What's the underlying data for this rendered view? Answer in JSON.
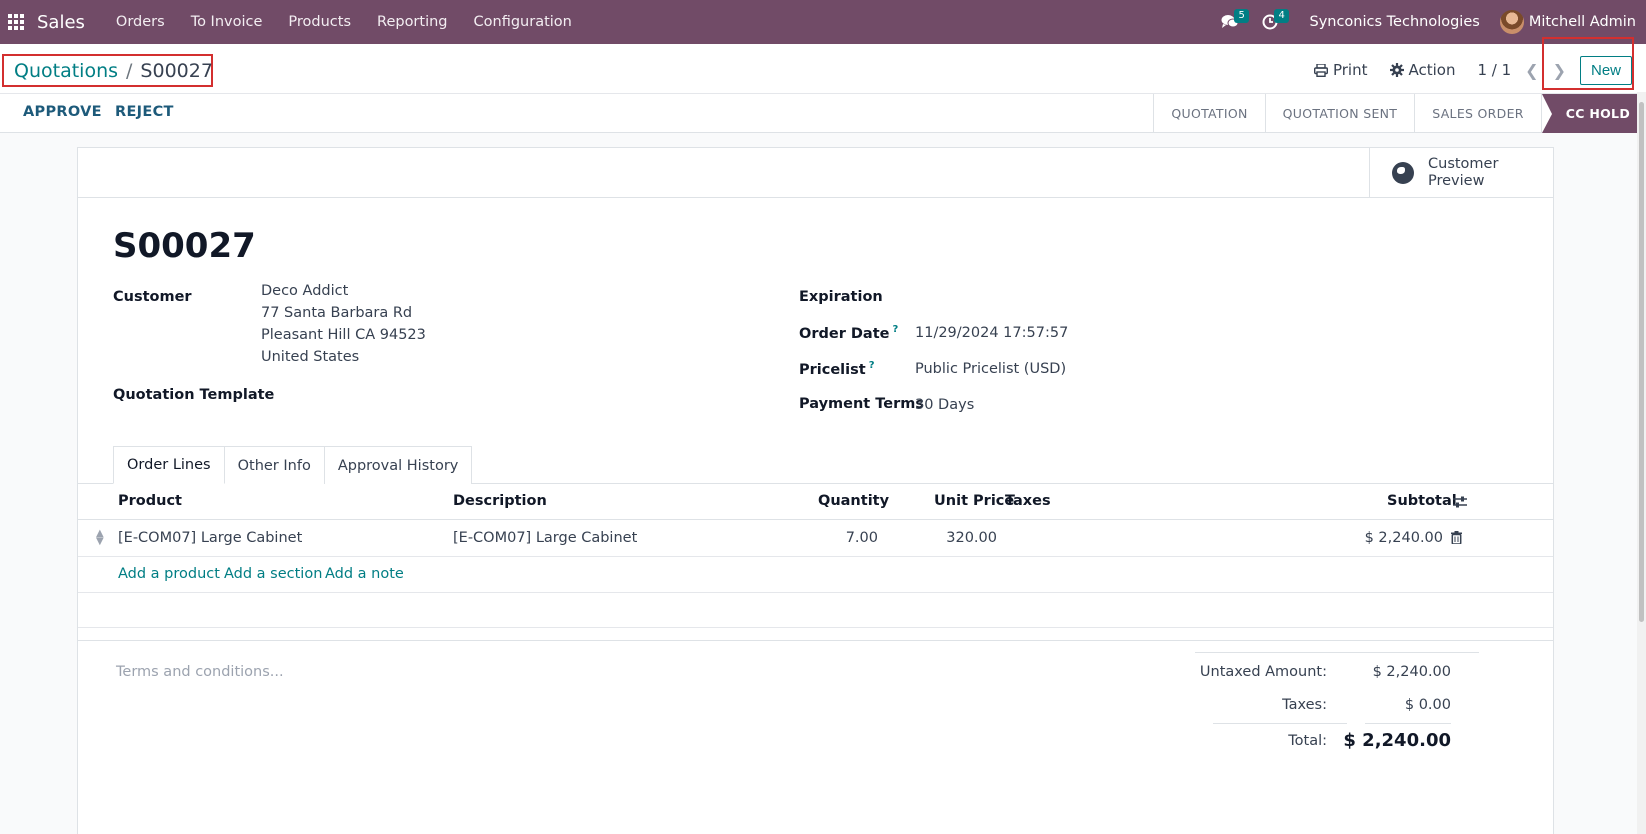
{
  "navbar": {
    "app_name": "Sales",
    "menu": [
      "Orders",
      "To Invoice",
      "Products",
      "Reporting",
      "Configuration"
    ],
    "messages_count": "5",
    "activities_count": "4",
    "company": "Synconics Technologies",
    "user": "Mitchell Admin"
  },
  "breadcrumb": {
    "parent": "Quotations",
    "separator": "/",
    "current": "S00027"
  },
  "control": {
    "print": "Print",
    "action": "Action",
    "pager": "1 / 1",
    "new": "New"
  },
  "actions": {
    "approve": "APPROVE",
    "reject": "REJECT"
  },
  "statusbar": {
    "stages": [
      "QUOTATION",
      "QUOTATION SENT",
      "SALES ORDER"
    ],
    "active": "CC HOLD"
  },
  "smart_buttons": {
    "preview_line1": "Customer",
    "preview_line2": "Preview"
  },
  "record": {
    "name": "S00027",
    "customer_label": "Customer",
    "customer": {
      "name": "Deco Addict",
      "street": "77 Santa Barbara Rd",
      "city": "Pleasant Hill CA 94523",
      "country": "United States"
    },
    "quotation_template_label": "Quotation Template",
    "expiration_label": "Expiration",
    "order_date_label": "Order Date",
    "order_date": "11/29/2024 17:57:57",
    "pricelist_label": "Pricelist",
    "pricelist": "Public Pricelist (USD)",
    "payment_terms_label": "Payment Terms",
    "payment_terms": "30 Days",
    "help_mark": "?"
  },
  "tabs": [
    "Order Lines",
    "Other Info",
    "Approval History"
  ],
  "order_lines": {
    "columns": {
      "product": "Product",
      "description": "Description",
      "quantity": "Quantity",
      "unit_price": "Unit Price",
      "taxes": "Taxes",
      "subtotal": "Subtotal"
    },
    "rows": [
      {
        "product": "[E-COM07] Large Cabinet",
        "description": "[E-COM07] Large Cabinet",
        "quantity": "7.00",
        "unit_price": "320.00",
        "taxes": "",
        "subtotal": "$ 2,240.00"
      }
    ],
    "add_product": "Add a product",
    "add_section": "Add a section",
    "add_note": "Add a note"
  },
  "footer": {
    "terms_placeholder": "Terms and conditions...",
    "untaxed_label": "Untaxed Amount:",
    "untaxed": "$ 2,240.00",
    "taxes_label": "Taxes:",
    "taxes": "$ 0.00",
    "total_label": "Total:",
    "total": "$ 2,240.00"
  },
  "colors": {
    "brand": "#714b67",
    "accent": "#017e84",
    "highlight": "#d32f2f"
  }
}
